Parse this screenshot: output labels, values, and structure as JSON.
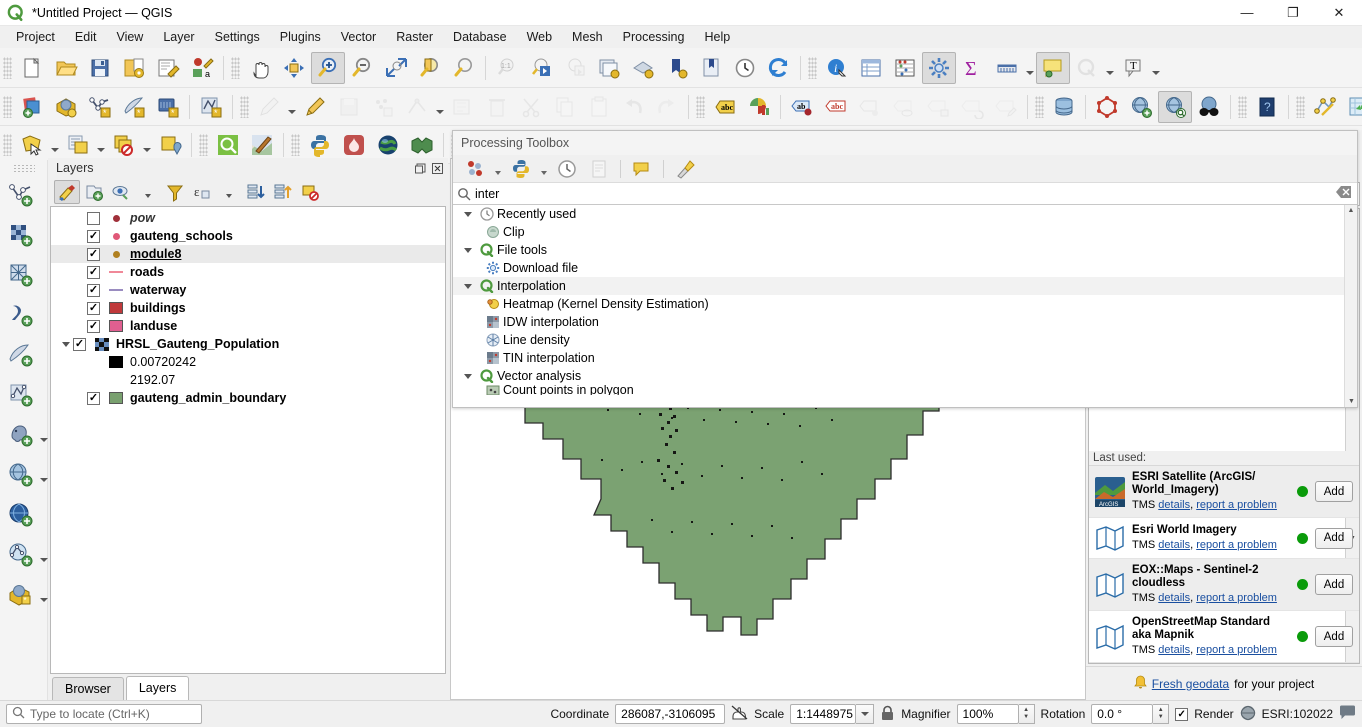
{
  "window": {
    "title": "*Untitled Project — QGIS",
    "logo_icon": "qgis-logo-icon",
    "minimize": "—",
    "maximize": "❐",
    "close": "✕"
  },
  "menubar": {
    "items": [
      {
        "label": "Project",
        "accel": "P"
      },
      {
        "label": "Edit",
        "accel": "E"
      },
      {
        "label": "View",
        "accel": "V"
      },
      {
        "label": "Layer",
        "accel": "L"
      },
      {
        "label": "Settings",
        "accel": "S"
      },
      {
        "label": "Plugins",
        "accel": "P"
      },
      {
        "label": "Vector",
        "accel": "o"
      },
      {
        "label": "Raster",
        "accel": "R"
      },
      {
        "label": "Database",
        "accel": "D"
      },
      {
        "label": "Web",
        "accel": "W"
      },
      {
        "label": "Mesh",
        "accel": "M"
      },
      {
        "label": "Processing",
        "accel": "c"
      },
      {
        "label": "Help",
        "accel": "H"
      }
    ]
  },
  "toolbars": {
    "row1": [
      {
        "name": "new-project-icon",
        "tip": "New Project"
      },
      {
        "name": "open-project-icon",
        "tip": "Open Project"
      },
      {
        "name": "save-project-icon",
        "tip": "Save Project"
      },
      {
        "name": "save-project-as-icon",
        "tip": "Save Project As"
      },
      {
        "name": "new-print-layout-icon",
        "tip": "New Print Layout"
      },
      {
        "name": "style-manager-icon",
        "tip": "Style Manager"
      },
      {
        "name": "pan-map-icon",
        "tip": "Pan Map"
      },
      {
        "name": "pan-to-selection-icon",
        "tip": "Pan Map to Selection"
      },
      {
        "name": "zoom-in-icon",
        "tip": "Zoom In",
        "active": true
      },
      {
        "name": "zoom-out-icon",
        "tip": "Zoom Out"
      },
      {
        "name": "zoom-full-icon",
        "tip": "Zoom Full"
      },
      {
        "name": "zoom-selection-icon",
        "tip": "Zoom To Selection"
      },
      {
        "name": "zoom-layer-icon",
        "tip": "Zoom To Layer"
      },
      {
        "name": "zoom-native-icon",
        "tip": "Zoom to Native Resolution",
        "disabled": true
      },
      {
        "name": "zoom-last-icon",
        "tip": "Zoom Last"
      },
      {
        "name": "zoom-next-icon",
        "tip": "Zoom Next",
        "disabled": true
      },
      {
        "name": "new-map-view-icon",
        "tip": "New Map View"
      },
      {
        "name": "new-3d-map-view-icon",
        "tip": "New 3D Map View"
      },
      {
        "name": "new-bookmark-icon",
        "tip": "New Spatial Bookmark"
      },
      {
        "name": "show-bookmarks-icon",
        "tip": "Show Spatial Bookmarks"
      },
      {
        "name": "temporal-controller-icon",
        "tip": "Temporal Controller Panel"
      },
      {
        "name": "refresh-icon",
        "tip": "Refresh"
      },
      {
        "name": "identify-features-icon",
        "tip": "Identify Features"
      },
      {
        "name": "open-attribute-table-icon",
        "tip": "Open Attribute Table"
      },
      {
        "name": "statistical-summary-icon",
        "tip": "Statistical Summary"
      },
      {
        "name": "processing-toolbox-icon",
        "tip": "Toolbox",
        "active": true
      },
      {
        "name": "sum-field-icon",
        "tip": "Field Calculator"
      },
      {
        "name": "measure-line-icon",
        "tip": "Measure Line",
        "caret": true
      },
      {
        "name": "map-tips-icon",
        "tip": "Show Map Tips",
        "active": true
      },
      {
        "name": "select-annotation-icon",
        "tip": "Annotations",
        "disabled": true,
        "caret": true
      },
      {
        "name": "text-annotation-icon",
        "tip": "Text Annotation",
        "caret": true
      }
    ],
    "row2": [
      {
        "name": "add-layer-icon",
        "tip": "Open Data Source Manager"
      },
      {
        "name": "add-wms-layer-icon",
        "tip": "Add Layer"
      },
      {
        "name": "new-shapefile-layer-icon",
        "tip": "New Shapefile Layer"
      },
      {
        "name": "new-spatialite-layer-icon",
        "tip": "New SpatiaLite Layer"
      },
      {
        "name": "new-geopackage-layer-icon",
        "tip": "New GeoPackage Layer"
      },
      {
        "name": "new-memory-layer-icon",
        "tip": "New Temporary Scratch Layer"
      },
      {
        "name": "toggle-editing-icon",
        "tip": "Toggle Editing",
        "disabled": true,
        "caret": true
      },
      {
        "name": "current-edits-icon",
        "tip": "Current Edits"
      },
      {
        "name": "save-layer-edits-icon",
        "tip": "Save Layer Edits",
        "disabled": true
      },
      {
        "name": "add-feature-icon",
        "tip": "Add Point Feature",
        "disabled": true
      },
      {
        "name": "vertex-tool-icon",
        "tip": "Vertex Tool",
        "disabled": true,
        "caret": true
      },
      {
        "name": "modify-attributes-icon",
        "tip": "Modify Attributes",
        "disabled": true
      },
      {
        "name": "delete-selected-icon",
        "tip": "Delete Selected",
        "disabled": true
      },
      {
        "name": "cut-features-icon",
        "tip": "Cut Features",
        "disabled": true
      },
      {
        "name": "copy-features-icon",
        "tip": "Copy Features",
        "disabled": true
      },
      {
        "name": "paste-features-icon",
        "tip": "Paste Features",
        "disabled": true
      },
      {
        "name": "undo-icon",
        "tip": "Undo",
        "disabled": true
      },
      {
        "name": "redo-icon",
        "tip": "Redo",
        "disabled": true
      },
      {
        "name": "label-layer-icon",
        "tip": "Layer Labeling Options"
      },
      {
        "name": "diagram-icon",
        "tip": "Layer Diagram Options"
      },
      {
        "name": "pin-labels-icon",
        "tip": "Pin/Unpin Labels"
      },
      {
        "name": "highlight-labels-icon",
        "tip": "Highlight Pinned Labels"
      },
      {
        "name": "move-label-icon",
        "tip": "Move a Label",
        "disabled": true
      },
      {
        "name": "show-hide-labels-icon",
        "tip": "Show/Hide Labels",
        "disabled": true
      },
      {
        "name": "change-label-icon",
        "tip": "Change Label",
        "disabled": true
      },
      {
        "name": "rotate-label-icon",
        "tip": "Rotate Label",
        "disabled": true
      },
      {
        "name": "edit-label-icon",
        "tip": "Edit Label",
        "disabled": true
      },
      {
        "name": "db-manager-icon",
        "tip": "DB Manager"
      },
      {
        "name": "topology-checker-icon",
        "tip": "Topology Checker"
      },
      {
        "name": "metasearch-add-icon",
        "tip": "MetaSearch"
      },
      {
        "name": "qms-search-icon",
        "tip": "Search QMS",
        "active": true
      },
      {
        "name": "osm-place-search-icon",
        "tip": "OSM Place Search"
      },
      {
        "name": "help-contents-icon",
        "tip": "Help Contents"
      },
      {
        "name": "qgis2web-icon",
        "tip": "qgis2web"
      },
      {
        "name": "refresh-table-icon",
        "tip": "Refresh"
      }
    ],
    "row3": [
      {
        "name": "select-features-icon",
        "tip": "Select Features by Area",
        "caret": true
      },
      {
        "name": "select-by-expression-icon",
        "tip": "Select by Expression",
        "caret": true
      },
      {
        "name": "deselect-features-icon",
        "tip": "Deselect Features",
        "caret": true
      },
      {
        "name": "select-value-icon",
        "tip": "Select Value"
      },
      {
        "name": "plugin-qms-icon",
        "tip": "QuickMapServices"
      },
      {
        "name": "plugin-mapswipe-icon",
        "tip": "Map Swipe Tool"
      },
      {
        "name": "python-console-icon",
        "tip": "Python Console"
      },
      {
        "name": "plugin-manager-icon",
        "tip": "Plugins"
      },
      {
        "name": "globe-plugin-icon",
        "tip": "Globe"
      },
      {
        "name": "qgis2web-export-icon",
        "tip": "qgis2web Export"
      }
    ],
    "vertical": [
      {
        "name": "add-vector-layer-icon",
        "tip": "Add Vector Layer"
      },
      {
        "name": "add-raster-layer-icon",
        "tip": "Add Raster Layer"
      },
      {
        "name": "add-mesh-layer-icon",
        "tip": "Add Mesh Layer"
      },
      {
        "name": "add-delimited-text-layer-icon",
        "tip": "Add Delimited Text Layer"
      },
      {
        "name": "add-spatialite-layer-icon",
        "tip": "Add SpatiaLite Layer"
      },
      {
        "name": "add-vectortile-layer-icon",
        "tip": "Add Vector Tile Layer"
      },
      {
        "name": "add-postgis-layer-icon",
        "tip": "Add PostGIS Layer",
        "caret": true
      },
      {
        "name": "add-wms-wmts-layer-icon",
        "tip": "Add WMS/WMTS Layer",
        "caret": true
      },
      {
        "name": "add-wcs-layer-icon",
        "tip": "Add WCS Layer"
      },
      {
        "name": "add-wfs-layer-icon",
        "tip": "Add WFS Layer",
        "caret": true
      },
      {
        "name": "add-arcgis-layer-icon",
        "tip": "Add ArcGIS REST Server Layer",
        "caret": true
      }
    ]
  },
  "layers_panel": {
    "title": "Layers",
    "undock_icon": "undock-icon",
    "close_icon": "close-icon",
    "toolbar": [
      {
        "name": "open-layer-styling-panel-icon",
        "active": true
      },
      {
        "name": "add-group-icon"
      },
      {
        "name": "manage-map-themes-icon",
        "caret": true
      },
      {
        "name": "filter-legend-icon"
      },
      {
        "name": "filter-legend-expression-icon",
        "caret": true
      },
      {
        "name": "expand-all-icon"
      },
      {
        "name": "collapse-all-icon"
      },
      {
        "name": "remove-layer-icon"
      }
    ],
    "items": [
      {
        "name": "pow",
        "checked": false,
        "symbol": "dot",
        "color": "#a0303a",
        "style": "italic",
        "indent": 1
      },
      {
        "name": "gauteng_schools",
        "checked": true,
        "symbol": "dot",
        "color": "#e05878",
        "style": "bold",
        "indent": 1
      },
      {
        "name": "module8",
        "checked": true,
        "symbol": "dot",
        "color": "#b08020",
        "style": "underline",
        "selected": true,
        "indent": 1
      },
      {
        "name": "roads",
        "checked": true,
        "symbol": "line",
        "color": "#f08898",
        "style": "bold",
        "indent": 1
      },
      {
        "name": "waterway",
        "checked": true,
        "symbol": "line",
        "color": "#9a8cc0",
        "style": "bold",
        "indent": 1
      },
      {
        "name": "buildings",
        "checked": true,
        "symbol": "box",
        "color": "#c0393b",
        "style": "bold",
        "indent": 1
      },
      {
        "name": "landuse",
        "checked": true,
        "symbol": "box",
        "color": "#e05f90",
        "style": "bold",
        "indent": 1
      },
      {
        "name": "HRSL_Gauteng_Population",
        "checked": true,
        "symbol": "raster",
        "color": "#1a2a55",
        "style": "bold",
        "expandable": true,
        "indent": 0
      },
      {
        "name": "0.00720242",
        "symbol": "box",
        "color": "#000000",
        "style": "plain",
        "child": true,
        "indent": 2
      },
      {
        "name": "2192.07",
        "symbol": "none",
        "style": "plain",
        "child": true,
        "indent": 2
      },
      {
        "name": "gauteng_admin_boundary",
        "checked": true,
        "symbol": "box",
        "color": "#79a06f",
        "style": "bold",
        "indent": 1
      }
    ],
    "tabs": [
      {
        "label": "Browser",
        "active": false
      },
      {
        "label": "Layers",
        "active": true
      }
    ]
  },
  "processing_toolbox": {
    "title": "Processing Toolbox",
    "toolbar": [
      {
        "name": "processing-models-icon",
        "caret": true
      },
      {
        "name": "processing-scripts-icon",
        "caret": true
      },
      {
        "name": "processing-history-icon"
      },
      {
        "name": "processing-results-icon",
        "dim": true
      },
      {
        "name": "processing-edit-icon"
      },
      {
        "name": "processing-options-icon"
      }
    ],
    "search": {
      "value": "inter",
      "icon": "search-icon",
      "clear_icon": "clear-icon"
    },
    "tree": [
      {
        "label": "Recently used",
        "level": 0,
        "icon": "clock-icon",
        "expanded": true
      },
      {
        "label": "Clip",
        "level": 1,
        "icon": "clip-algorithm-icon"
      },
      {
        "label": "File tools",
        "level": 0,
        "icon": "qgis-provider-icon",
        "expanded": true
      },
      {
        "label": "Download file",
        "level": 1,
        "icon": "gear-blue-icon"
      },
      {
        "label": "Interpolation",
        "level": 0,
        "icon": "qgis-provider-icon",
        "expanded": true,
        "highlight": true
      },
      {
        "label": "Heatmap (Kernel Density Estimation)",
        "level": 1,
        "icon": "heatmap-icon"
      },
      {
        "label": "IDW interpolation",
        "level": 1,
        "icon": "raster-interp-icon"
      },
      {
        "label": "Line density",
        "level": 1,
        "icon": "line-density-icon"
      },
      {
        "label": "TIN interpolation",
        "level": 1,
        "icon": "raster-interp-icon"
      },
      {
        "label": "Vector analysis",
        "level": 0,
        "icon": "qgis-provider-icon",
        "expanded": true
      },
      {
        "label": "Count points in polygon",
        "level": 1,
        "icon": "count-points-icon",
        "clipped": true
      }
    ]
  },
  "right_panel": {
    "close_icon": "close-icon",
    "search_clear_icon": "clear-search-icon",
    "last_used_label": "Last used:",
    "services": [
      {
        "name": "ESRI Satellite (ArcGIS/ World_Imagery)",
        "type": "TMS",
        "details_label": "details",
        "separator": ",",
        "report_label": "report a problem",
        "status_color": "#0a9b0a",
        "add_label": "Add",
        "icon": "esri-satellite-thumb-icon"
      },
      {
        "name": "Esri World Imagery",
        "type": "TMS",
        "details_label": "details",
        "separator": ",",
        "report_label": "report a problem",
        "status_color": "#0a9b0a",
        "add_label": "Add",
        "icon": "map-thumb-icon"
      },
      {
        "name": "EOX::Maps - Sentinel-2 cloudless",
        "type": "TMS",
        "details_label": "details",
        "separator": ",",
        "report_label": "report a problem",
        "status_color": "#0a9b0a",
        "add_label": "Add",
        "icon": "map-thumb-icon"
      },
      {
        "name": "OpenStreetMap Standard aka Mapnik",
        "type": "TMS",
        "details_label": "details",
        "separator": ",",
        "report_label": "report a problem",
        "status_color": "#0a9b0a",
        "add_label": "Add",
        "icon": "map-thumb-icon"
      }
    ],
    "footer": {
      "bell_icon": "bell-icon",
      "link_label": "Fresh geodata",
      "suffix": " for your project"
    }
  },
  "map": {
    "boundary_fill": "#7ba272",
    "boundary_stroke": "#2d2d2d",
    "schools_color": "#e8738f",
    "schools_stroke": "#8c2f46",
    "population_color": "#101010",
    "roads_color": "#b0a8cc",
    "landuse_color": "#e05f90"
  },
  "statusbar": {
    "locator_placeholder": "Type to locate (Ctrl+K)",
    "locator_icon": "search-icon",
    "coordinate_label": "Coordinate",
    "coordinate_value": "286087,-3106095",
    "coordinate_toggle_icon": "toggle-extents-icon",
    "scale_label": "Scale",
    "scale_value": "1:1448975",
    "lock_icon": "lock-icon",
    "magnifier_label": "Magnifier",
    "magnifier_value": "100%",
    "rotation_label": "Rotation",
    "rotation_value": "0.0 °",
    "render_label": "Render",
    "render_checked": true,
    "crs_icon": "crs-globe-icon",
    "crs_value": "ESRI:102022",
    "messages_icon": "messages-icon"
  }
}
